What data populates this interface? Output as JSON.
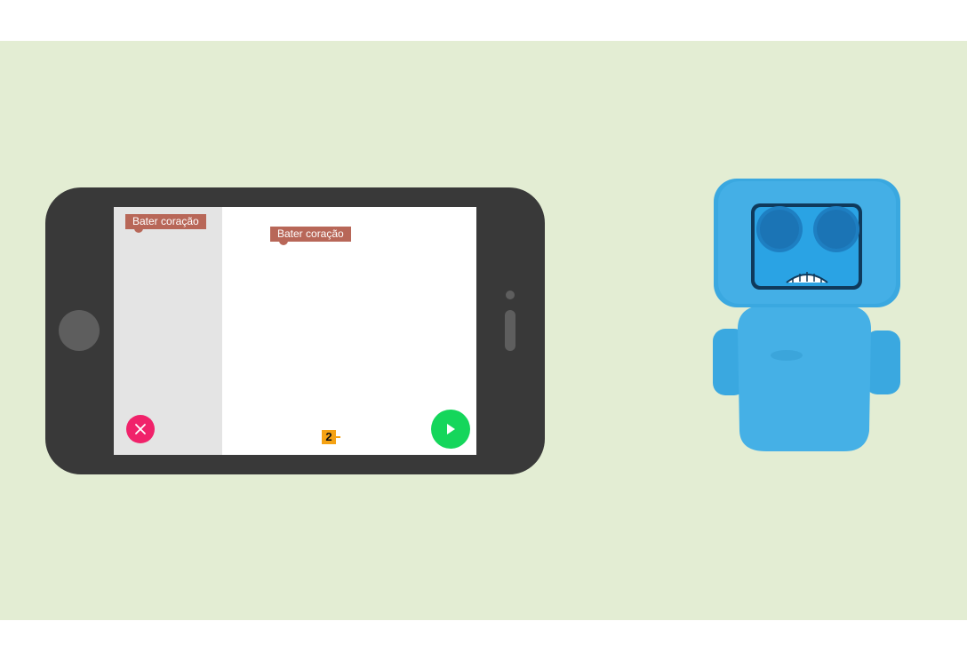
{
  "palette": {
    "block_label": "Bater coração"
  },
  "workspace": {
    "block_label": "Bater coração",
    "counter_value": "2"
  },
  "buttons": {
    "clear_icon": "close-icon",
    "run_icon": "play-icon"
  },
  "colors": {
    "background": "#e3edd3",
    "phone_body": "#393939",
    "palette_bg": "#e4e4e4",
    "block": "#b86758",
    "clear_button": "#f0226a",
    "run_button": "#15d65b",
    "counter": "#f5a213",
    "robot": "#3aa8e0"
  }
}
